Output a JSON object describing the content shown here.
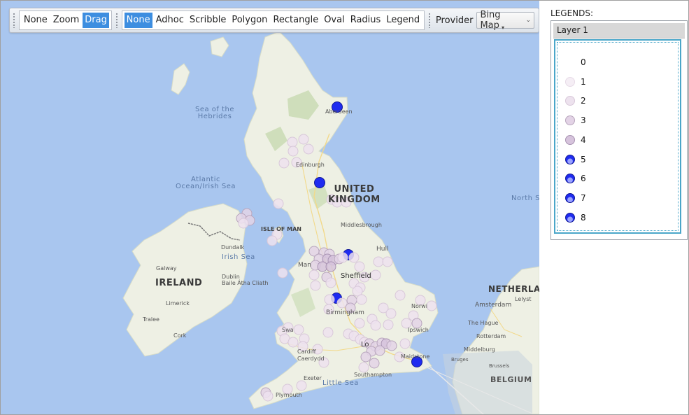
{
  "toolbar": {
    "mode_buttons": [
      "None",
      "Zoom",
      "Drag"
    ],
    "draw_buttons": [
      "None",
      "Adhoc",
      "Scribble",
      "Polygon",
      "Rectangle",
      "Oval",
      "Radius",
      "Legend"
    ],
    "provider_label": "Provider",
    "provider_value": "Bing Map",
    "overflow_icon": "overflow-chevron-icon"
  },
  "map": {
    "labels": {
      "sea_hebrides": "Sea of the\nHebrides",
      "atlantic": "Atlantic\nOcean/Irish Sea",
      "irish_sea": "Irish Sea",
      "north_sea": "North S",
      "little_sea": "Little Sea",
      "uk": "UNITED\nKINGDOM",
      "ireland": "IRELAND",
      "netherlands": "NETHERLAN",
      "belgium": "BELGIUM",
      "isle_of_man": "ISLE OF MAN",
      "aberdeen": "Aberdeen",
      "edinburgh": "Edinburgh",
      "middlesbrough": "Middlesbrough",
      "hull": "Hull",
      "manchester": "Man",
      "sheffield": "Sheffield",
      "birmingham": "Birmingham",
      "norwich": "Norwi",
      "ipswich": "Ipswich",
      "cardiff": "Cardiff\nCaerdydd",
      "swansea": "Swa",
      "london": "Lo",
      "maidstone": "Maidstone",
      "southampton": "Southampton",
      "exeter": "Exeter",
      "plymouth": "Plymouth",
      "dundalk": "Dundalk",
      "galway": "Galway",
      "dublin": "Dublin\nBaile Átha Cliath",
      "limerick": "Limerick",
      "tralee": "Tralee",
      "cork": "Cork",
      "amsterdam": "Amsterdam",
      "the_hague": "The Hague",
      "rotterdam": "Rotterdam",
      "middelburg": "Middelburg",
      "lelystad": "Lelyst",
      "bruges": "Bruges",
      "brussels": "Brussels"
    },
    "bins": [
      {
        "value": 0,
        "fill": "#ffffff",
        "stroke": "#ffffff"
      },
      {
        "value": 1,
        "fill": "#f5eef5",
        "stroke": "#e7dbe7"
      },
      {
        "value": 2,
        "fill": "#ede2ee",
        "stroke": "#d8c8d9"
      },
      {
        "value": 3,
        "fill": "#e3d3e6",
        "stroke": "#b8a6bd"
      },
      {
        "value": 4,
        "fill": "#d6c3dc",
        "stroke": "#a893b2"
      },
      {
        "value": 5,
        "fill": "#1f2bf0",
        "stroke": "#121a96"
      },
      {
        "value": 6,
        "fill": "#1f2bf0",
        "stroke": "#121a96"
      },
      {
        "value": 7,
        "fill": "#1f2bf0",
        "stroke": "#121a96"
      },
      {
        "value": 8,
        "fill": "#1f2bf0",
        "stroke": "#121a96"
      }
    ],
    "points": [
      [
        481,
        152,
        6
      ],
      [
        433,
        198,
        2
      ],
      [
        417,
        202,
        2
      ],
      [
        418,
        215,
        2
      ],
      [
        440,
        212,
        2
      ],
      [
        405,
        232,
        2
      ],
      [
        423,
        231,
        2
      ],
      [
        456,
        260,
        6
      ],
      [
        397,
        290,
        2
      ],
      [
        473,
        284,
        2
      ],
      [
        481,
        288,
        2
      ],
      [
        494,
        288,
        2
      ],
      [
        352,
        304,
        3
      ],
      [
        344,
        311,
        3
      ],
      [
        356,
        314,
        3
      ],
      [
        347,
        318,
        2
      ],
      [
        395,
        334,
        2
      ],
      [
        388,
        343,
        2
      ],
      [
        497,
        363,
        6
      ],
      [
        448,
        358,
        3
      ],
      [
        462,
        360,
        3
      ],
      [
        470,
        362,
        3
      ],
      [
        455,
        369,
        3
      ],
      [
        467,
        369,
        4
      ],
      [
        475,
        371,
        4
      ],
      [
        484,
        369,
        3
      ],
      [
        450,
        378,
        3
      ],
      [
        460,
        380,
        4
      ],
      [
        472,
        380,
        4
      ],
      [
        448,
        392,
        2
      ],
      [
        466,
        395,
        3
      ],
      [
        489,
        367,
        2
      ],
      [
        505,
        367,
        2
      ],
      [
        513,
        380,
        2
      ],
      [
        540,
        373,
        2
      ],
      [
        553,
        373,
        2
      ],
      [
        536,
        392,
        2
      ],
      [
        520,
        395,
        2
      ],
      [
        505,
        404,
        2
      ],
      [
        514,
        410,
        2
      ],
      [
        510,
        415,
        2
      ],
      [
        472,
        403,
        2
      ],
      [
        450,
        407,
        2
      ],
      [
        403,
        389,
        2
      ],
      [
        480,
        425,
        6
      ],
      [
        470,
        427,
        2
      ],
      [
        488,
        432,
        2
      ],
      [
        502,
        428,
        3
      ],
      [
        516,
        427,
        2
      ],
      [
        500,
        439,
        3
      ],
      [
        469,
        441,
        2
      ],
      [
        547,
        439,
        2
      ],
      [
        571,
        421,
        2
      ],
      [
        600,
        428,
        2
      ],
      [
        616,
        436,
        2
      ],
      [
        590,
        450,
        2
      ],
      [
        580,
        461,
        2
      ],
      [
        595,
        461,
        3
      ],
      [
        558,
        447,
        2
      ],
      [
        554,
        463,
        2
      ],
      [
        531,
        455,
        2
      ],
      [
        513,
        461,
        2
      ],
      [
        536,
        464,
        2
      ],
      [
        468,
        474,
        2
      ],
      [
        497,
        476,
        2
      ],
      [
        411,
        467,
        2
      ],
      [
        426,
        470,
        2
      ],
      [
        402,
        472,
        2
      ],
      [
        406,
        483,
        2
      ],
      [
        434,
        483,
        2
      ],
      [
        418,
        488,
        2
      ],
      [
        432,
        494,
        2
      ],
      [
        453,
        498,
        2
      ],
      [
        462,
        517,
        2
      ],
      [
        505,
        479,
        2
      ],
      [
        514,
        484,
        2
      ],
      [
        520,
        488,
        2
      ],
      [
        527,
        490,
        3
      ],
      [
        536,
        494,
        3
      ],
      [
        545,
        489,
        3
      ],
      [
        551,
        490,
        4
      ],
      [
        559,
        493,
        3
      ],
      [
        530,
        501,
        3
      ],
      [
        542,
        500,
        3
      ],
      [
        522,
        509,
        3
      ],
      [
        534,
        518,
        3
      ],
      [
        519,
        524,
        2
      ],
      [
        578,
        490,
        2
      ],
      [
        570,
        509,
        2
      ],
      [
        595,
        516,
        6
      ],
      [
        430,
        550,
        2
      ],
      [
        410,
        555,
        2
      ],
      [
        379,
        560,
        3
      ],
      [
        382,
        565,
        2
      ]
    ]
  },
  "legend": {
    "title": "LEGENDS:",
    "layer": "Layer 1",
    "items": [
      "0",
      "1",
      "2",
      "3",
      "4",
      "5",
      "6",
      "7",
      "8"
    ]
  }
}
